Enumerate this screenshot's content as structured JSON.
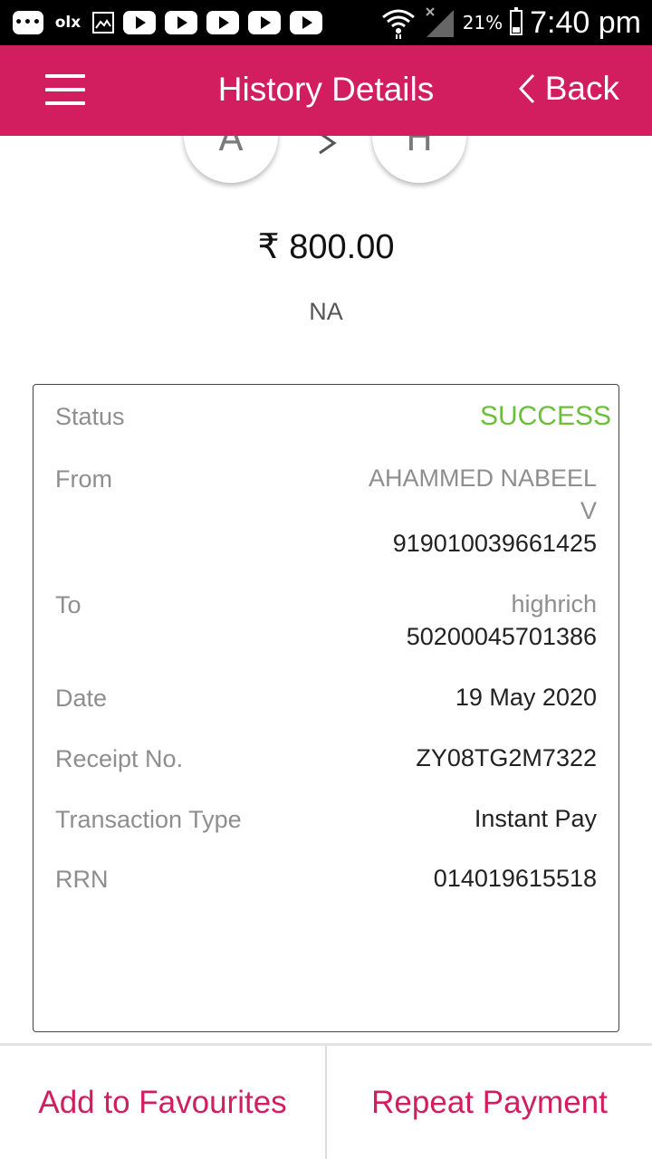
{
  "status_bar": {
    "battery_percent": "21%",
    "time": "7:40 pm",
    "icons": [
      "messages-icon",
      "olx-icon",
      "gallery-icon",
      "youtube-icon",
      "youtube-icon",
      "youtube-icon",
      "youtube-icon",
      "youtube-icon",
      "wifi-icon",
      "signal-icon",
      "battery-icon"
    ],
    "olx_label": "olx"
  },
  "header": {
    "title": "History Details",
    "back_label": "Back",
    "color": "#d21d5e"
  },
  "transaction": {
    "from_initial": "A",
    "to_initial": "H",
    "amount": "₹ 800.00",
    "remark": "NA"
  },
  "details": {
    "status_label": "Status",
    "status_value": "SUCCESS",
    "status_color": "#6cbf3b",
    "from_label": "From",
    "from_name_line1": "AHAMMED NABEEL",
    "from_name_line2": "V",
    "from_account": "919010039661425",
    "to_label": "To",
    "to_name": "highrich",
    "to_account": "50200045701386",
    "date_label": "Date",
    "date_value": "19 May 2020",
    "receipt_label": "Receipt No.",
    "receipt_value": "ZY08TG2M7322",
    "type_label": "Transaction Type",
    "type_value": "Instant Pay",
    "rrn_label": "RRN",
    "rrn_value": "014019615518"
  },
  "actions": {
    "add_favourites": "Add to Favourites",
    "repeat_payment": "Repeat Payment"
  }
}
